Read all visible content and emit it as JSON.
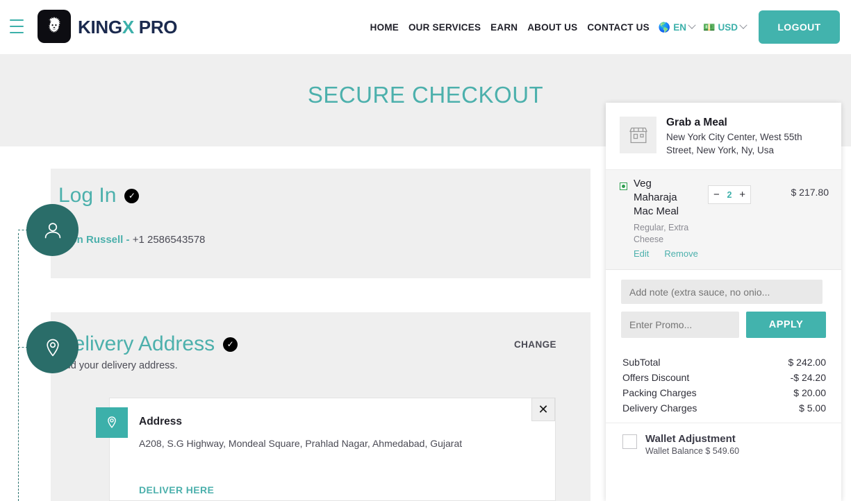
{
  "header": {
    "menu_icon": "hamburger-icon",
    "logo_icon": "lion-logo-icon",
    "brand_prefix": "KING",
    "brand_x": "X",
    "brand_suffix": " PRO",
    "nav": [
      {
        "label": "HOME"
      },
      {
        "label": "OUR SERVICES"
      },
      {
        "label": "EARN"
      },
      {
        "label": "ABOUT US"
      },
      {
        "label": "CONTACT US"
      }
    ],
    "language": {
      "icon": "globe-icon",
      "value": "EN"
    },
    "currency": {
      "icon": "money-icon",
      "value": "USD"
    },
    "logout_label": "LOGOUT",
    "accent_color": "#42b3ad"
  },
  "hero": {
    "title": "SECURE CHECKOUT",
    "background": "#efefef"
  },
  "steps": {
    "login": {
      "icon": "user-icon",
      "title": "Log In",
      "completed_icon": "check-circle-icon",
      "customer_name": "Zyon Russell -",
      "customer_phone": "+1 2586543578"
    },
    "delivery": {
      "icon": "map-pin-icon",
      "title": "Delivery Address",
      "completed_icon": "check-circle-icon",
      "subtitle": "Add your delivery address.",
      "change_label": "CHANGE",
      "card": {
        "pin_icon": "map-pin-icon",
        "close_icon": "close-icon",
        "title": "Address",
        "text": "A208, S.G Highway, Mondeal Square, Prahlad Nagar, Ahmedabad, Gujarat",
        "deliver_label": "DELIVER HERE"
      }
    }
  },
  "cart": {
    "store": {
      "thumb_icon": "storefront-icon",
      "name": "Grab a Meal",
      "address": "New York City Center, West 55th Street, New York, Ny, Usa"
    },
    "item": {
      "veg_icon": "veg-mark-icon",
      "name": "Veg Maharaja Mac Meal",
      "options": "Regular, Extra Cheese",
      "edit_label": "Edit",
      "remove_label": "Remove",
      "minus_icon": "minus-icon",
      "plus_icon": "plus-icon",
      "quantity": "2",
      "price": "$ 217.80"
    },
    "note_placeholder": "Add note (extra sauce, no onio...",
    "promo_placeholder": "Enter Promo...",
    "apply_label": "APPLY",
    "totals": [
      {
        "label": "SubTotal",
        "value": "$ 242.00"
      },
      {
        "label": "Offers Discount",
        "value": "-$ 24.20"
      },
      {
        "label": "Packing Charges",
        "value": "$ 20.00"
      },
      {
        "label": "Delivery Charges",
        "value": "$ 5.00"
      }
    ],
    "wallet": {
      "checkbox_icon": "checkbox-icon",
      "title": "Wallet Adjustment",
      "balance": "Wallet Balance $ 549.60"
    }
  }
}
